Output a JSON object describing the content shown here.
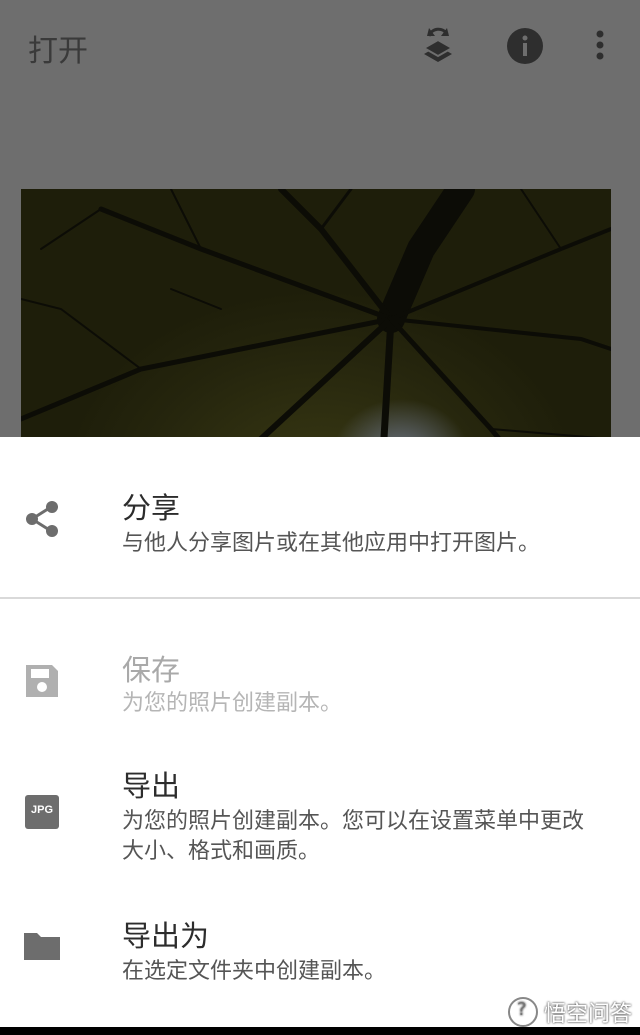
{
  "app_bar": {
    "title": "打开",
    "icons": [
      "layers-refresh-icon",
      "info-icon",
      "more-vert-icon"
    ]
  },
  "photo": {
    "alt": ""
  },
  "sheet": {
    "items": [
      {
        "title": "分享",
        "subtitle": "与他人分享图片或在其他应用中打开图片。",
        "icon": "share-icon",
        "enabled": true
      },
      {
        "title": "保存",
        "subtitle": "为您的照片创建副本。",
        "icon": "save-icon",
        "enabled": false
      },
      {
        "title": "导出",
        "subtitle": "为您的照片创建副本。您可以在设置菜单中更改大小、格式和画质。",
        "icon": "jpg-icon",
        "icon_text": "JPG",
        "enabled": true
      },
      {
        "title": "导出为",
        "subtitle": "在选定文件夹中创建副本。",
        "icon": "folder-icon",
        "enabled": true
      }
    ]
  },
  "watermark": {
    "text": "悟空问答"
  },
  "colors": {
    "scrim": "#6e6e6e",
    "sheet": "#ffffff",
    "icon_gray": "#6d6d6d",
    "icon_disabled": "#b0b0b0"
  }
}
